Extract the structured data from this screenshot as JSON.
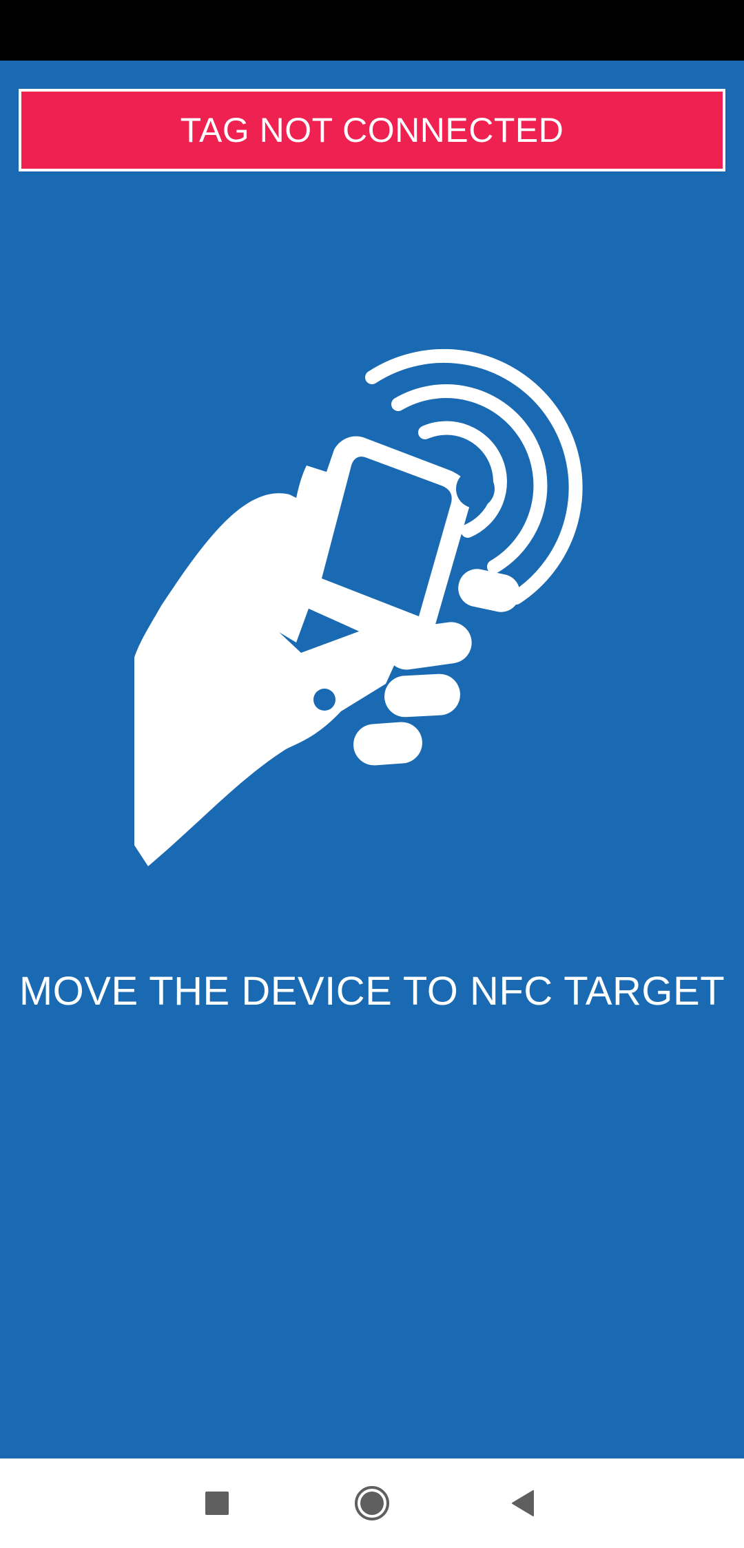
{
  "banner": {
    "text": "TAG NOT CONNECTED",
    "color": "#EF2150",
    "border_color": "#FFFFFF"
  },
  "illustration": {
    "icon": "hand-phone-nfc-icon"
  },
  "instruction": {
    "text": "MOVE THE DEVICE TO NFC TARGET"
  },
  "theme": {
    "background": "#1A6AB3",
    "foreground": "#FFFFFF"
  },
  "navigation": {
    "buttons": [
      "recents-icon",
      "home-icon",
      "back-icon"
    ],
    "icon_color": "#5F5F5F"
  }
}
